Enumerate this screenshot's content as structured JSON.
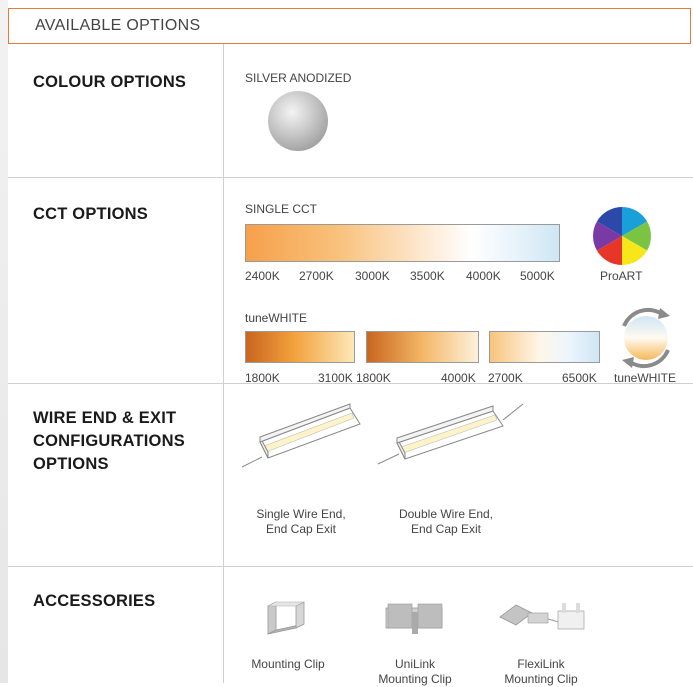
{
  "header": {
    "title": "AVAILABLE OPTIONS"
  },
  "colour": {
    "title": "COLOUR OPTIONS",
    "finish_label": "SILVER ANODIZED"
  },
  "cct": {
    "title": "CCT OPTIONS",
    "single_label": "SINGLE CCT",
    "single_ticks": [
      "2400K",
      "2700K",
      "3000K",
      "3500K",
      "4000K",
      "5000K"
    ],
    "proart_label": "ProART",
    "tunewhite_label": "tuneWHITE",
    "tune_ranges": [
      {
        "start": "1800K",
        "end": "3100K"
      },
      {
        "start": "1800K",
        "end": "4000K"
      },
      {
        "start": "2700K",
        "end": "6500K"
      }
    ],
    "tunewhite_icon_label": "tuneWHITE"
  },
  "wire": {
    "title_lines": [
      "WIRE END & EXIT",
      "CONFIGURATIONS",
      "OPTIONS"
    ],
    "options": [
      {
        "line1": "Single Wire End,",
        "line2": "End Cap Exit"
      },
      {
        "line1": "Double Wire End,",
        "line2": "End Cap Exit"
      }
    ]
  },
  "accessories": {
    "title": "ACCESSORIES",
    "items": [
      {
        "line1": "Mounting Clip",
        "line2": ""
      },
      {
        "line1": "UniLink",
        "line2": "Mounting Clip"
      },
      {
        "line1": "FlexiLink",
        "line2": "Mounting Clip"
      }
    ]
  },
  "colors": {
    "accent_border": "#e8793a",
    "silver": "#c8c8c8"
  }
}
